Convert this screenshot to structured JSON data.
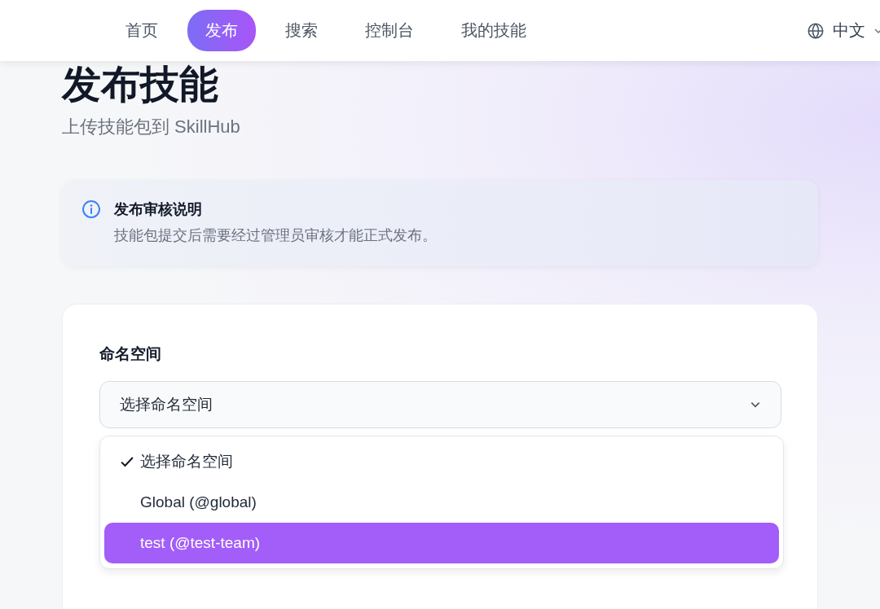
{
  "nav": {
    "items": [
      {
        "label": "首页",
        "selected": false
      },
      {
        "label": "发布",
        "selected": true
      },
      {
        "label": "搜索",
        "selected": false
      },
      {
        "label": "控制台",
        "selected": false
      },
      {
        "label": "我的技能",
        "selected": false
      }
    ],
    "language": "中文"
  },
  "page": {
    "title": "发布技能",
    "subtitle": "上传技能包到 SkillHub"
  },
  "notice": {
    "title": "发布审核说明",
    "text": "技能包提交后需要经过管理员审核才能正式发布。"
  },
  "form": {
    "namespace_label": "命名空间",
    "namespace_select": {
      "value": "选择命名空间",
      "expanded": true,
      "options": [
        {
          "label": "选择命名空间",
          "selected": true,
          "highlighted": false
        },
        {
          "label": "Global (@global)",
          "selected": false,
          "highlighted": false
        },
        {
          "label": "test (@test-team)",
          "selected": false,
          "highlighted": true
        }
      ]
    }
  }
}
